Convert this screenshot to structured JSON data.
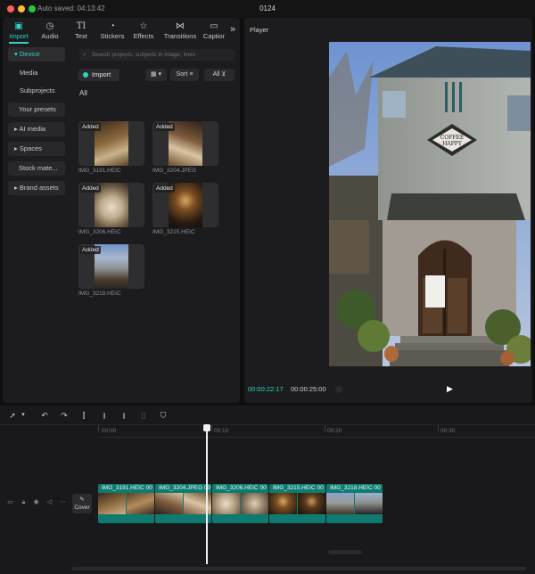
{
  "window": {
    "autosave": "Auto saved: 04:13:42",
    "title": "0124"
  },
  "tabs": [
    {
      "label": "Import",
      "icon": "import-icon"
    },
    {
      "label": "Audio",
      "icon": "audio-icon"
    },
    {
      "label": "Text",
      "icon": "text-icon"
    },
    {
      "label": "Stickers",
      "icon": "stickers-icon"
    },
    {
      "label": "Effects",
      "icon": "effects-icon"
    },
    {
      "label": "Transitions",
      "icon": "transitions-icon"
    },
    {
      "label": "Captior",
      "icon": "captions-icon"
    }
  ],
  "sidebar": {
    "items": [
      {
        "label": "Device"
      },
      {
        "label": "Media"
      },
      {
        "label": "Subprojects"
      },
      {
        "label": "Your presets"
      },
      {
        "label": "AI media"
      },
      {
        "label": "Spaces"
      },
      {
        "label": "Stock mate..."
      },
      {
        "label": "Brand assets"
      }
    ]
  },
  "media": {
    "search_placeholder": "Search projects, subjects in image, lines",
    "import_label": "Import",
    "sort_label": "Sort",
    "filter_label": "All",
    "section_label": "All",
    "added_badge": "Added",
    "files": [
      {
        "name": "IMG_3191.HEIC"
      },
      {
        "name": "IMG_3204.JPEG"
      },
      {
        "name": "IMG_3206.HEIC"
      },
      {
        "name": "IMG_3215.HEIC"
      },
      {
        "name": "IMG_3218.HEIC"
      }
    ]
  },
  "player": {
    "title": "Player",
    "current_time": "00:00:22:17",
    "duration": "00:00:25:00",
    "sign_text": "COFFEE HAPPY"
  },
  "timeline": {
    "ticks": [
      "00:00",
      "00:10",
      "00:20",
      "00:30"
    ],
    "cover_label": "Cover",
    "clips": [
      {
        "label": "IMG_3191.HEIC  00"
      },
      {
        "label": "IMG_3204.JPEG  00"
      },
      {
        "label": "IMG_3206.HEIC  00"
      },
      {
        "label": "IMG_3215.HEIC  00"
      },
      {
        "label": "IMG_3218.HEIC  00"
      }
    ]
  },
  "colors": {
    "accent": "#33d0c8",
    "clip": "#0f7b70"
  }
}
